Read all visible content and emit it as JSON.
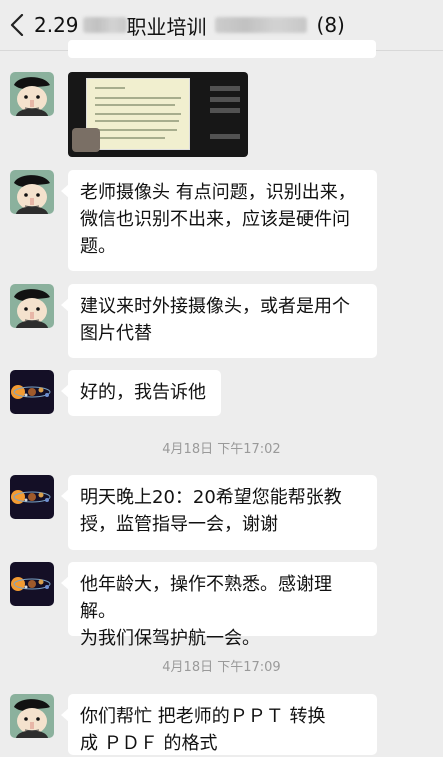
{
  "header": {
    "title_prefix": "2.29",
    "title_middle": "职业培训",
    "member_count": "(8)"
  },
  "messages": [
    {
      "avatar": "cartoon-avatar",
      "type": "image"
    },
    {
      "avatar": "cartoon-avatar",
      "text_lines": [
        "老师摄像头 有点问题，识别出来，",
        "微信也识别不出来，应该是硬件问",
        "题。"
      ]
    },
    {
      "avatar": "cartoon-avatar",
      "text_lines": [
        "建议来时外接摄像头，或者是用个",
        "图片代替"
      ]
    },
    {
      "avatar": "planet-avatar",
      "text_lines": [
        "好的，我告诉他"
      ]
    },
    {
      "timestamp": "4月18日 下午17:02"
    },
    {
      "avatar": "planet-avatar",
      "text_lines": [
        "明天晚上20：20希望您能帮张教",
        "授，监管指导一会，谢谢"
      ]
    },
    {
      "avatar": "planet-avatar",
      "text_lines": [
        "他年龄大，操作不熟悉。感谢理解。",
        "为我们保驾护航一会。"
      ]
    },
    {
      "timestamp": "4月18日 下午17:09"
    },
    {
      "avatar": "cartoon-avatar",
      "text_lines": [
        "你们帮忙  把老师的ＰＰＴ  转换",
        "成  ＰＤＦ  的格式"
      ]
    }
  ]
}
